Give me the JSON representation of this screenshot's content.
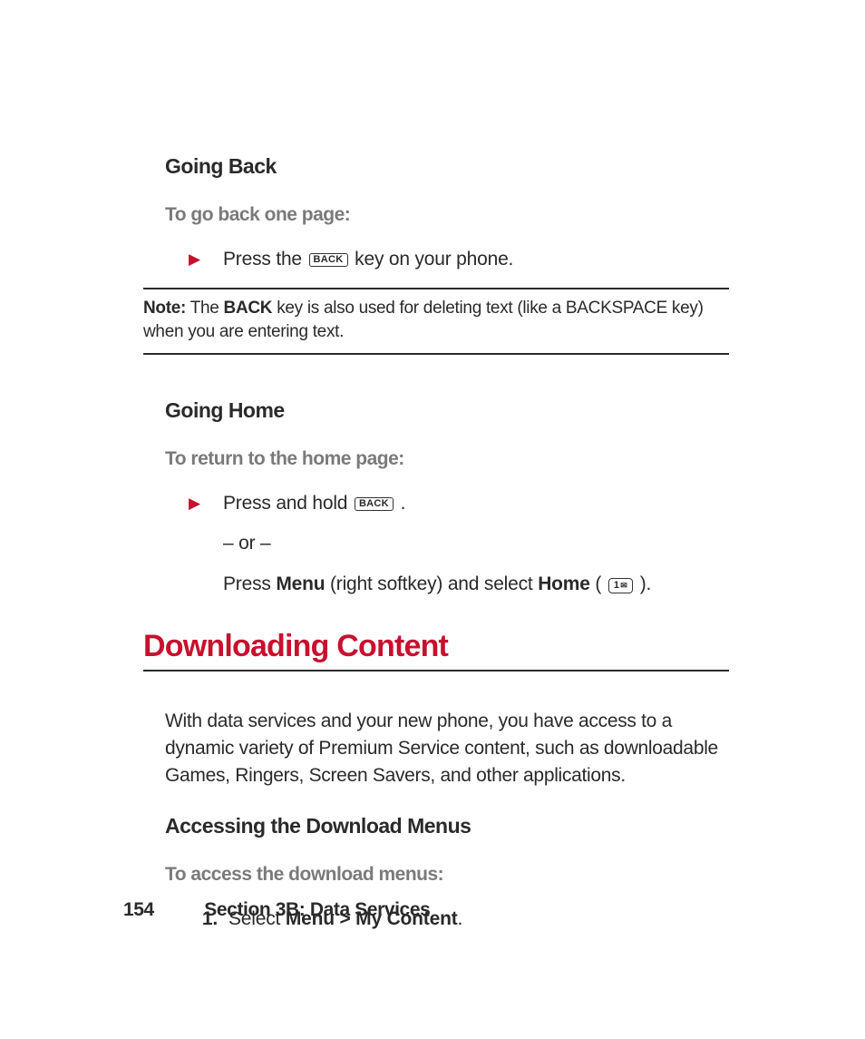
{
  "goingBack": {
    "title": "Going Back",
    "sub": "To go back one page:",
    "step_pre": "Press the ",
    "key": "BACK",
    "step_post": " key on your phone."
  },
  "note": {
    "label": "Note:",
    "pre": " The ",
    "bold": "BACK",
    "post": " key is also used for deleting text (like a BACKSPACE key) when you are entering text."
  },
  "goingHome": {
    "title": "Going Home",
    "sub": "To return to the home page:",
    "step1_pre": "Press and hold ",
    "key": "BACK",
    "step1_post": " .",
    "or": "– or –",
    "step2_a": "Press ",
    "step2_menu": "Menu",
    "step2_b": " (right softkey) and select ",
    "step2_home": "Home",
    "step2_c": " ( ",
    "key1": "1",
    "step2_d": " )."
  },
  "download": {
    "h1": "Downloading Content",
    "intro": "With data services and your new phone, you have access to a dynamic variety of Premium Service content, such as downloadable Games, Ringers, Screen Savers, and other applications.",
    "h3": "Accessing the Download Menus",
    "sub": "To access the download menus:",
    "num": "1.",
    "step_a": "Select ",
    "step_b": "Menu > My Content",
    "step_c": "."
  },
  "footer": {
    "page": "154",
    "section": "Section 3B: Data Services"
  }
}
